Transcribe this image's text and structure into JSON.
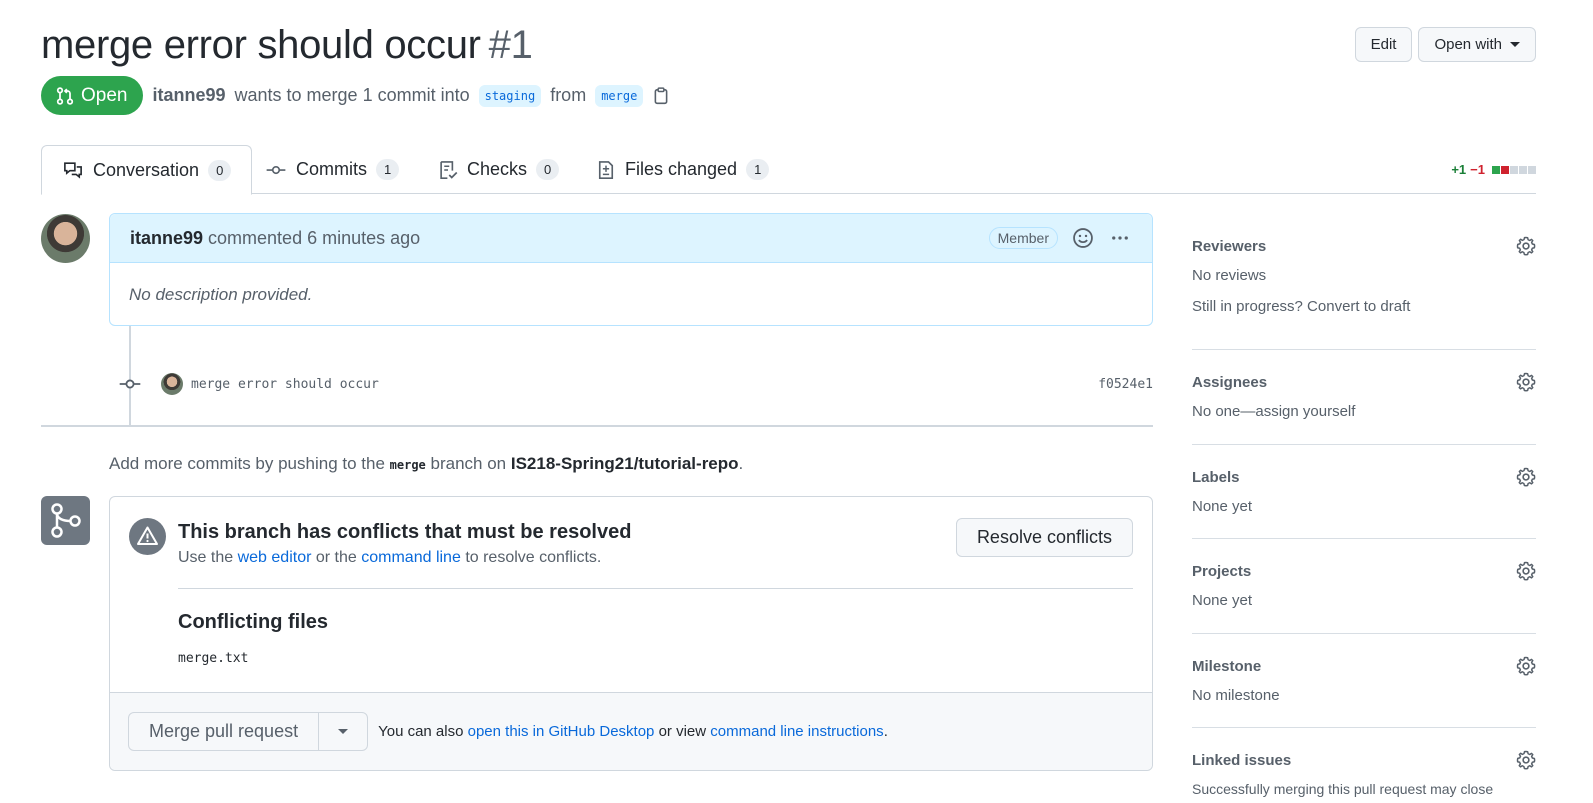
{
  "header": {
    "title": "merge error should occur",
    "number": "#1",
    "edit_label": "Edit",
    "open_with_label": "Open with"
  },
  "meta": {
    "state": "Open",
    "author": "itanne99",
    "text_before": "wants to merge 1 commit into",
    "base_branch": "staging",
    "from_text": "from",
    "head_branch": "merge"
  },
  "tabs": [
    {
      "label": "Conversation",
      "count": "0"
    },
    {
      "label": "Commits",
      "count": "1"
    },
    {
      "label": "Checks",
      "count": "0"
    },
    {
      "label": "Files changed",
      "count": "1"
    }
  ],
  "diffstat": {
    "added": "+1",
    "removed": "−1"
  },
  "comment": {
    "author": "itanne99",
    "action": "commented 6 minutes ago",
    "role": "Member",
    "body": "No description provided."
  },
  "commit": {
    "message": "merge error should occur",
    "sha": "f0524e1"
  },
  "push_hint": {
    "prefix": "Add more commits by pushing to the",
    "branch": "merge",
    "middle": "branch on",
    "repo": "IS218-Spring21/tutorial-repo",
    "suffix": "."
  },
  "merge_box": {
    "conflict_title": "This branch has conflicts that must be resolved",
    "sub_prefix": "Use the",
    "web_editor": "web editor",
    "sub_middle": "or the",
    "command_line": "command line",
    "sub_suffix": "to resolve conflicts.",
    "resolve_label": "Resolve conflicts",
    "conflicting_title": "Conflicting files",
    "files": [
      "merge.txt"
    ],
    "merge_label": "Merge pull request",
    "also_prefix": "You can also",
    "desktop_link": "open this in GitHub Desktop",
    "also_middle": "or view",
    "cli_link": "command line instructions",
    "also_suffix": "."
  },
  "sidebar": {
    "reviewers": {
      "title": "Reviewers",
      "text": "No reviews",
      "extra": "Still in progress? Convert to draft"
    },
    "assignees": {
      "title": "Assignees",
      "text": "No one—assign yourself"
    },
    "labels": {
      "title": "Labels",
      "text": "None yet"
    },
    "projects": {
      "title": "Projects",
      "text": "None yet"
    },
    "milestone": {
      "title": "Milestone",
      "text": "No milestone"
    },
    "linked": {
      "title": "Linked issues",
      "text": "Successfully merging this pull request may close"
    }
  },
  "colors": {
    "open_green": "#2da44e",
    "link_blue": "#0969da",
    "comment_header_bg": "#ddf4ff",
    "diff_add": "#1a7f37",
    "diff_del": "#cf222e"
  }
}
